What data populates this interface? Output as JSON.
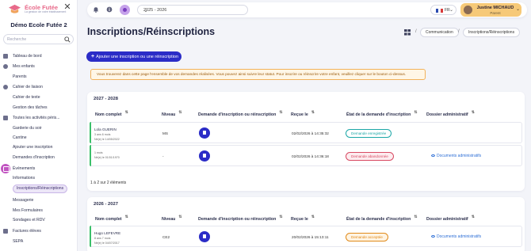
{
  "brand": {
    "name": "École Futée",
    "tagline": "La gestion de votre établissement",
    "school": "Démo Ecole Futée 2"
  },
  "search": {
    "placeholder": "Recherche"
  },
  "sidebar": {
    "items": [
      {
        "label": "Tableau de bord",
        "icon": "dashboard-icon"
      },
      {
        "label": "Mes enfants",
        "icon": "children-icon"
      },
      {
        "label": "Parents",
        "icon": ""
      },
      {
        "label": "Cahier de liaison",
        "icon": "notebook-icon"
      },
      {
        "label": "Cahier de texte",
        "icon": ""
      },
      {
        "label": "Gestion des tâches",
        "icon": ""
      },
      {
        "label": "Toutes les activités péris...",
        "icon": "activities-icon"
      },
      {
        "label": "Garderie du soir",
        "icon": ""
      },
      {
        "label": "Cantine",
        "icon": ""
      },
      {
        "label": "Ajouter une inscription",
        "icon": ""
      },
      {
        "label": "Demandes d'inscription",
        "icon": ""
      },
      {
        "label": "Événements",
        "icon": "events-icon"
      },
      {
        "label": "Informations",
        "icon": ""
      },
      {
        "label": "Inscriptions/Réinscriptions",
        "icon": "",
        "active": true
      },
      {
        "label": "Messagerie",
        "icon": ""
      },
      {
        "label": "Mes Formulaires",
        "icon": ""
      },
      {
        "label": "Sondages et RDV",
        "icon": ""
      },
      {
        "label": "Factures élèves",
        "icon": "invoice-icon"
      },
      {
        "label": "SEPA",
        "icon": ""
      }
    ]
  },
  "topbar": {
    "year": "2025 - 2026",
    "lang_code": "FR",
    "user_name": "Justine MICHAUD",
    "user_role": "Parent"
  },
  "page": {
    "title": "Inscriptions/Réinscriptions",
    "breadcrumb": [
      "Communication",
      "Inscriptions/Réinscriptions"
    ],
    "add_button": "Ajouter une inscription ou une réinscription",
    "notice": "Vous trouverez dans cette page l'ensemble de vos demandes réalisées. Vous pouvez ainsi suivre leur statut. Pour inscrire ou réinscrire votre enfant, veuillez cliquer sur le bouton ci-dessus."
  },
  "columns": [
    "Nom complet",
    "Niveau",
    "Demande d'inscription ou réinscription",
    "Reçue le",
    "État de la demande d'inscription",
    "Dossier administratif"
  ],
  "tables": [
    {
      "year": "2027 - 2028",
      "count_text": "1 à 2 sur 2 éléments",
      "rows": [
        {
          "name": "Lola GUERIN",
          "age": "3 ans 6 mois",
          "born": "Né(e) le 14/05/2022",
          "level": "MS",
          "received": "02/02/2026 à 14:35:32",
          "status": "Demande enregistrée",
          "status_color": "#1ca7a7",
          "dossier": "",
          "bar_color": "#3bbf6a"
        },
        {
          "name": "",
          "age": "1 mois",
          "born": "Né(e) le 01/01/1970",
          "level": "-",
          "received": "02/02/2026 à 14:36:18",
          "status": "Demande abandonnée",
          "status_color": "#d84a63",
          "dossier": "Documents administratifs",
          "bar_color": "#3bbf6a"
        }
      ]
    },
    {
      "year": "2026 - 2027",
      "rows": [
        {
          "name": "Hugo LEFEVRE",
          "age": "8 ans 7 mois",
          "born": "Né(e) le 04/07/2017",
          "level": "CE2",
          "received": "20/02/2026 à 15:13:11",
          "status": "Demande acceptée",
          "status_color": "#e08a1a",
          "dossier": "Documents administratifs",
          "bar_color": "#3bbf6a"
        }
      ]
    }
  ]
}
